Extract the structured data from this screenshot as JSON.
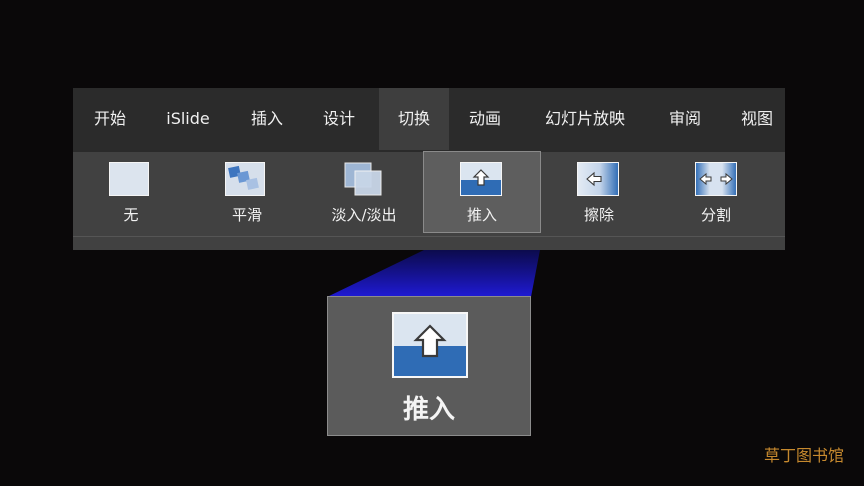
{
  "tabs": [
    "开始",
    "iSlide",
    "插入",
    "设计",
    "切换",
    "动画",
    "幻灯片放映",
    "审阅",
    "视图"
  ],
  "active_tab": "切换",
  "transitions": [
    {
      "label": "无",
      "icon": "none-transition-icon"
    },
    {
      "label": "平滑",
      "icon": "morph-transition-icon"
    },
    {
      "label": "淡入/淡出",
      "icon": "fade-transition-icon"
    },
    {
      "label": "推入",
      "icon": "push-transition-icon"
    },
    {
      "label": "擦除",
      "icon": "wipe-transition-icon"
    },
    {
      "label": "分割",
      "icon": "split-transition-icon"
    }
  ],
  "selected_transition": "推入",
  "zoom": {
    "label": "推入",
    "icon": "push-transition-icon"
  },
  "watermark": "草丁图书馆",
  "colors": {
    "background": "#0a0809",
    "ribbon": "#2b2b2b",
    "beam": "#1c18c8",
    "accent_blue": "#2a66b0"
  }
}
